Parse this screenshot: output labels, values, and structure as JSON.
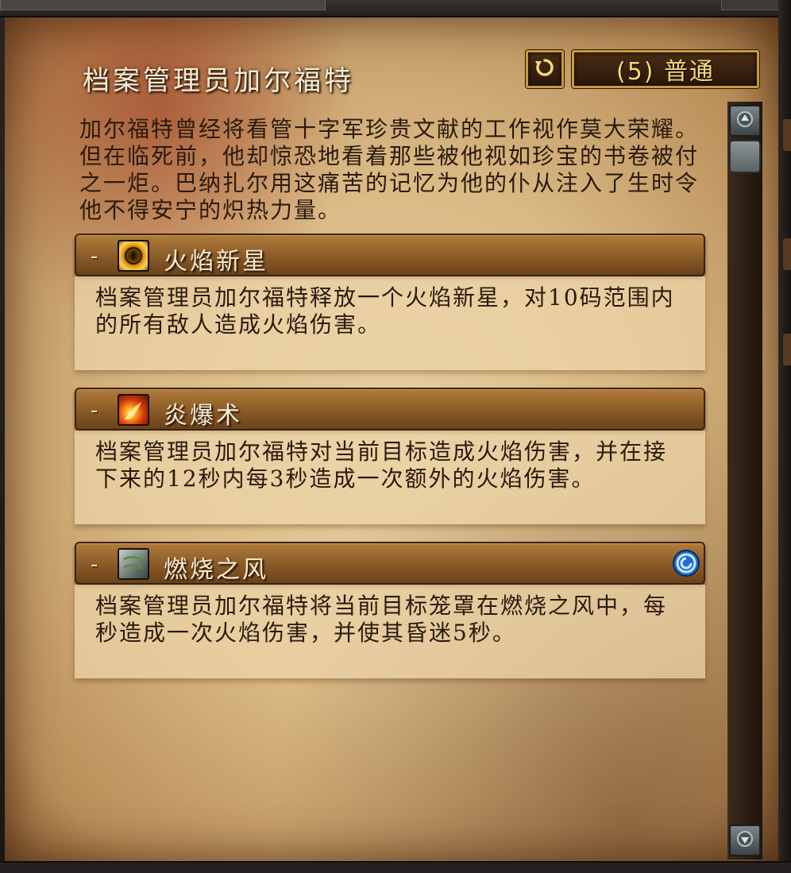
{
  "header": {
    "title": "档案管理员加尔福特",
    "reset_icon": "reset-arrow-icon",
    "difficulty_label": "(5) 普通"
  },
  "description": "加尔福特曾经将看管十字军珍贵文献的工作视作莫大荣耀。但在临死前，他却惊恐地看着那些被他视如珍宝的书卷被付之一炬。巴纳扎尔用这痛苦的记忆为他的仆从注入了生时令他不得安宁的炽热力量。",
  "abilities": [
    {
      "toggle": "-",
      "icon": "fire-nova-icon",
      "name": "火焰新星",
      "text": "档案管理员加尔福特释放一个火焰新星，对10码范围内的所有敌人造成火焰伤害。"
    },
    {
      "toggle": "-",
      "icon": "pyroblast-icon",
      "name": "炎爆术",
      "text": "档案管理员加尔福特对当前目标造成火焰伤害，并在接下来的12秒内每3秒造成一次额外的火焰伤害。"
    },
    {
      "toggle": "-",
      "icon": "burning-winds-icon",
      "name": "燃烧之风",
      "flag_icon": "interruptible-icon",
      "text": "档案管理员加尔福特将当前目标笼罩在燃烧之风中，每秒造成一次火焰伤害，并使其昏迷5秒。"
    }
  ],
  "colors": {
    "title": "#f7ecd4",
    "difficulty": "#f5d87a",
    "body_text": "#2a1a0e",
    "header_bar": "#8a5a26",
    "button_border": "#c79a3e"
  }
}
